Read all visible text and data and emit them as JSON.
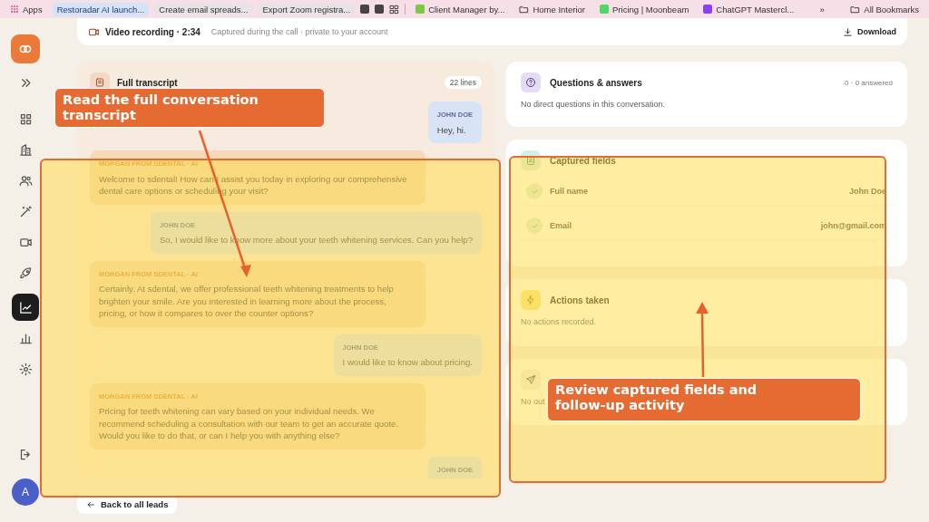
{
  "bookmarks": [
    {
      "kind": "apps",
      "label": "Apps"
    },
    {
      "kind": "chip",
      "label": "Restoradar AI launch...",
      "selected": true
    },
    {
      "kind": "chip",
      "label": "Create email spreads...",
      "selected": false
    },
    {
      "kind": "chip",
      "label": "Export Zoom registra...",
      "selected": false
    },
    {
      "kind": "square"
    },
    {
      "kind": "square"
    },
    {
      "kind": "grid"
    },
    {
      "kind": "divider"
    },
    {
      "kind": "site",
      "label": "Client Manager by...",
      "color": "#7ac943"
    },
    {
      "kind": "folder",
      "label": "Home Interior"
    },
    {
      "kind": "site",
      "label": "Pricing | Moonbeam",
      "color": "#4cd964"
    },
    {
      "kind": "site",
      "label": "ChatGPT Mastercl...",
      "color": "#8a3ffc"
    },
    {
      "kind": "more",
      "label": "»"
    },
    {
      "kind": "folder",
      "label": "All Bookmarks"
    }
  ],
  "sidebar": {
    "items": [
      {
        "selected": false
      },
      {
        "selected": false
      },
      {
        "selected": false
      },
      {
        "selected": false
      },
      {
        "selected": false
      },
      {
        "selected": false
      },
      {
        "selected": false
      },
      {
        "selected": true
      },
      {
        "selected": false
      },
      {
        "selected": false
      },
      {
        "selected": false
      }
    ],
    "avatar": "A"
  },
  "recording": {
    "title": "Video recording · 2:34",
    "subtitle": "Captured during the call · private to your account",
    "download": "Download"
  },
  "transcript": {
    "title": "Full transcript",
    "count": "22 lines",
    "messages": [
      {
        "kind": "user",
        "sender": "JOHN DOE",
        "text": "Hey, hi."
      },
      {
        "kind": "agent",
        "sender": "MORGAN FROM SDENTAL · AI",
        "text": "Welcome to sdental! How can I assist you today in exploring our comprehensive dental care options or scheduling your visit?"
      },
      {
        "kind": "user",
        "sender": "JOHN DOE",
        "text": "So, I would like to know more about your teeth whitening services. Can you help?"
      },
      {
        "kind": "agent",
        "sender": "MORGAN FROM SDENTAL · AI",
        "text": "Certainly. At sdental, we offer professional teeth whitening treatments to help brighten your smile. Are you interested in learning more about the process, pricing, or how it compares to over the counter options?"
      },
      {
        "kind": "user",
        "sender": "JOHN DOE",
        "text": "I would like to know about pricing."
      },
      {
        "kind": "agent",
        "sender": "MORGAN FROM SDENTAL · AI",
        "text": "Pricing for teeth whitening can vary based on your individual needs. We recommend scheduling a consultation with our team to get an accurate quote. Would you like to do that, or can I help you with anything else?"
      },
      {
        "kind": "user",
        "sender": "JOHN DOE"
      }
    ]
  },
  "back_link": "Back to all leads",
  "questions": {
    "title": "Questions & answers",
    "count": "0 · 0 answered",
    "empty": "No direct questions in this conversation."
  },
  "captured": {
    "title": "Captured fields",
    "fields": [
      {
        "label": "Full name",
        "value": "John Doe",
        "checked": true
      },
      {
        "label": "Email",
        "value": "john@gmail.com",
        "checked": true
      }
    ]
  },
  "actions": {
    "title": "Actions taken",
    "empty": "No actions recorded."
  },
  "delivery": {
    "empty": "No out"
  },
  "annotations": [
    {
      "text": "Read the full conversation transcript"
    },
    {
      "text": "Review captured fields and follow-up activity"
    }
  ]
}
